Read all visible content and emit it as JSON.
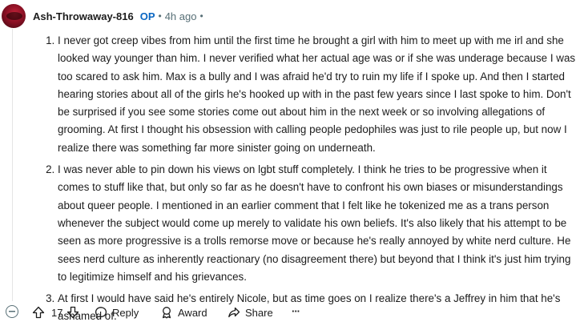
{
  "comment": {
    "author": "Ash-Throwaway-816",
    "op_badge": "OP",
    "separator": "•",
    "time": "4h ago",
    "separator2": "•",
    "items": [
      "I never got creep vibes from him until the first time he brought a girl with him to meet up with me irl and she looked way younger than him. I never verified what her actual age was or if she was underage because I was too scared to ask him. Max is a bully and I was afraid he'd try to ruin my life if I spoke up. And then I started hearing stories about all of the girls he's hooked up with in the past few years since I last spoke to him. Don't be surprised if you see some stories come out about him in the next week or so involving allegations of grooming. At first I thought his obsession with calling people pedophiles was just to rile people up, but now I realize there was something far more sinister going on underneath.",
      "I was never able to pin down his views on lgbt stuff completely. I think he tries to be progressive when it comes to stuff like that, but only so far as he doesn't have to confront his own biases or misunderstandings about queer people. I mentioned in an earlier comment that I felt like he tokenized me as a trans person whenever the subject would come up merely to validate his own beliefs. It's also likely that his attempt to be seen as more progressive is a trolls remorse move or because he's really annoyed by white nerd culture. He sees nerd culture as inherently reactionary (no disagreement there) but beyond that I think it's just him trying to legitimize himself and his grievances.",
      "At first I would have said he's entirely Nicole, but as time goes on I realize there's a Jeffrey in him that he's ashamed of."
    ]
  },
  "actions": {
    "vote_count": "17",
    "reply_label": "Reply",
    "award_label": "Award",
    "share_label": "Share",
    "more_label": "···"
  },
  "icons": {
    "collapse": "collapse-minus-icon",
    "upvote": "upvote-arrow-icon",
    "downvote": "downvote-arrow-icon",
    "reply": "reply-bubble-icon",
    "award": "award-ribbon-icon",
    "share": "share-arrow-icon"
  },
  "colors": {
    "op": "#0a66c2",
    "meta": "#576f76",
    "text": "#1c1c1c"
  }
}
